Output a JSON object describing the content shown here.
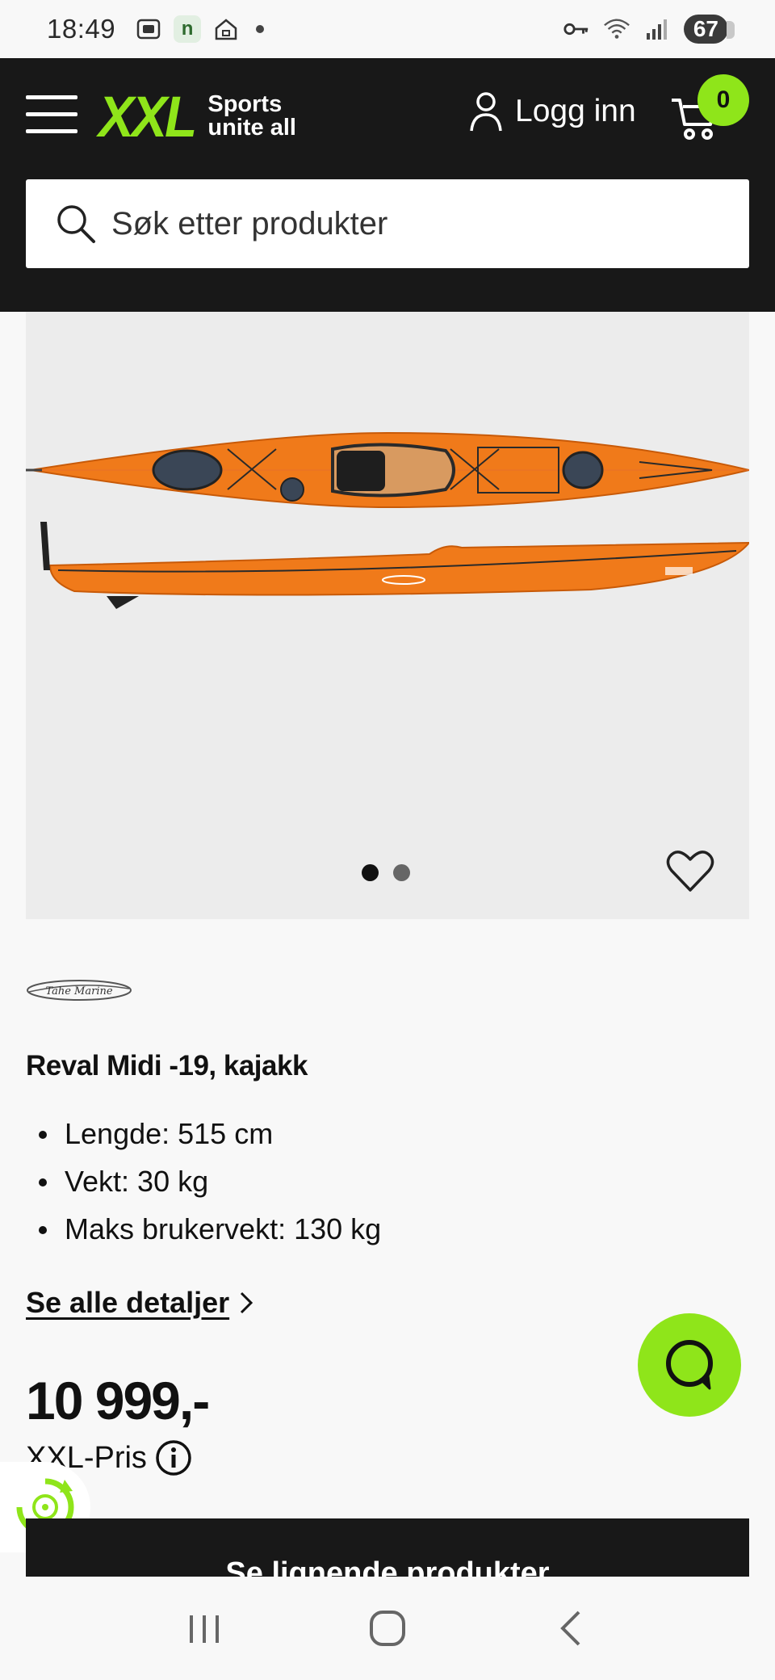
{
  "status_bar": {
    "time": "18:49",
    "battery": "67"
  },
  "header": {
    "logo_text": "XXL",
    "logo_tagline_1": "Sports",
    "logo_tagline_2": "unite all",
    "login_label": "Logg inn",
    "cart_count": "0",
    "search_placeholder": "Søk etter produkter"
  },
  "gallery": {
    "image_count": 2,
    "active_index": 0
  },
  "product": {
    "brand": "Tahe Marine",
    "title": "Reval Midi -19, kajakk",
    "specs": [
      "Lengde: 515 cm",
      "Vekt: 30 kg",
      "Maks brukervekt: 130 kg"
    ],
    "details_link": "Se alle detaljer",
    "price": "10 999,-",
    "price_label": "XXL-Pris"
  },
  "cta": {
    "label": "Se lignende produkter"
  },
  "colors": {
    "brand_green": "#8fe51a",
    "header_bg": "#181818",
    "kayak_orange": "#f07a1a"
  }
}
